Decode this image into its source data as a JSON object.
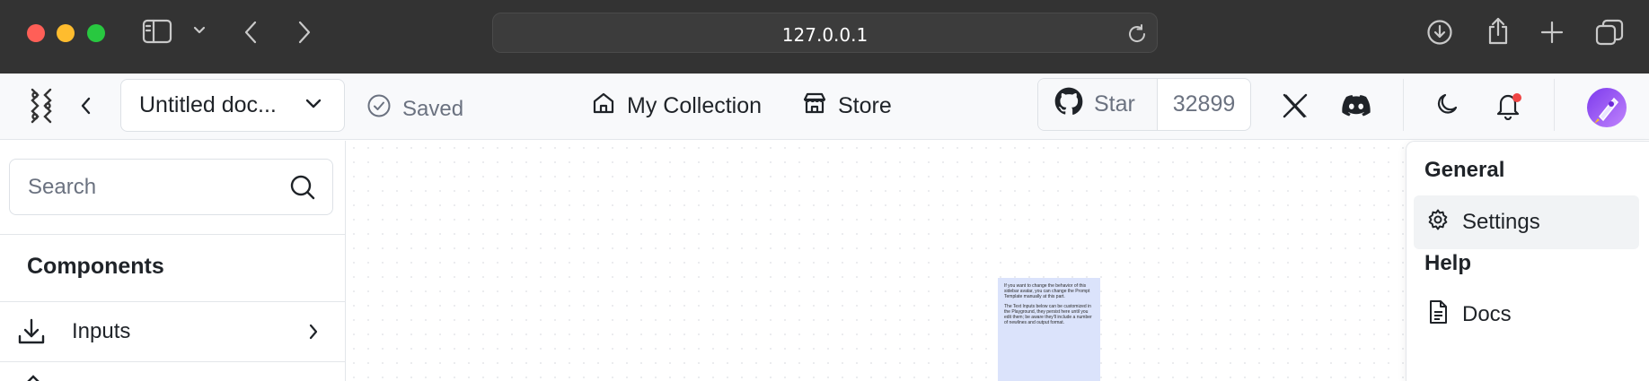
{
  "browser": {
    "url": "127.0.0.1"
  },
  "header": {
    "doc_title": "Untitled doc...",
    "status": "Saved",
    "nav": [
      {
        "label": "My Collection"
      },
      {
        "label": "Store"
      }
    ],
    "github": {
      "star_label": "Star",
      "count": "32899"
    }
  },
  "sidebar": {
    "search_placeholder": "Search",
    "section_title": "Components",
    "items": [
      {
        "label": "Inputs"
      }
    ]
  },
  "canvas": {
    "note_paragraphs": [
      "If you want to change the behavior of this sidebar avatar, you can change the Prompt Template manually at this part.",
      "The Text Inputs below can be customized in the Playground, they persist here until you edit them; be aware they'll include a number of newlines and output format."
    ]
  },
  "menu": {
    "general_heading": "General",
    "settings_label": "Settings",
    "help_heading": "Help",
    "docs_label": "Docs"
  },
  "colors": {
    "chrome_bg": "#333333",
    "header_bg": "#f8f9fb",
    "note_bg": "#dbe3fb",
    "notification_dot": "#ef4444"
  }
}
